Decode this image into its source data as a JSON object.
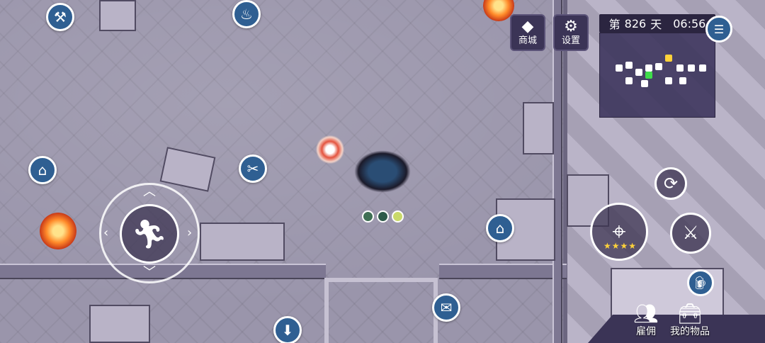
{
  "hud": {
    "shop_button": {
      "label": "商城",
      "icon": "diamond-icon"
    },
    "settings_button": {
      "label": "设置",
      "icon": "gear-icon"
    },
    "day_counter": {
      "prefix": "第",
      "day": "826",
      "suffix": "天",
      "time": "06:56"
    }
  },
  "controls": {
    "joystick": {
      "icon": "running-man-icon"
    },
    "swap_button": {
      "icon": "refresh-icon"
    },
    "weapon_button": {
      "icon": "crosshair-weapon-icon",
      "stars": 4
    },
    "secondary_weapon_button": {
      "icon": "crossed-blades-icon"
    },
    "drink_button": {
      "icon": "beer-mug-icon"
    }
  },
  "bottom_bar": {
    "hire_label": "雇佣",
    "items_label": "我的物品"
  },
  "map_icons": [
    {
      "name": "crafting-icon"
    },
    {
      "name": "furnace-icon"
    },
    {
      "name": "igloo-icon"
    },
    {
      "name": "saw-icon"
    },
    {
      "name": "dog-house-icon"
    },
    {
      "name": "mail-icon"
    },
    {
      "name": "save-icon"
    }
  ],
  "colors": {
    "icon_blue": "#2f5f92",
    "panel_purple": "#3b3456",
    "star_gold": "#ffd23a"
  }
}
